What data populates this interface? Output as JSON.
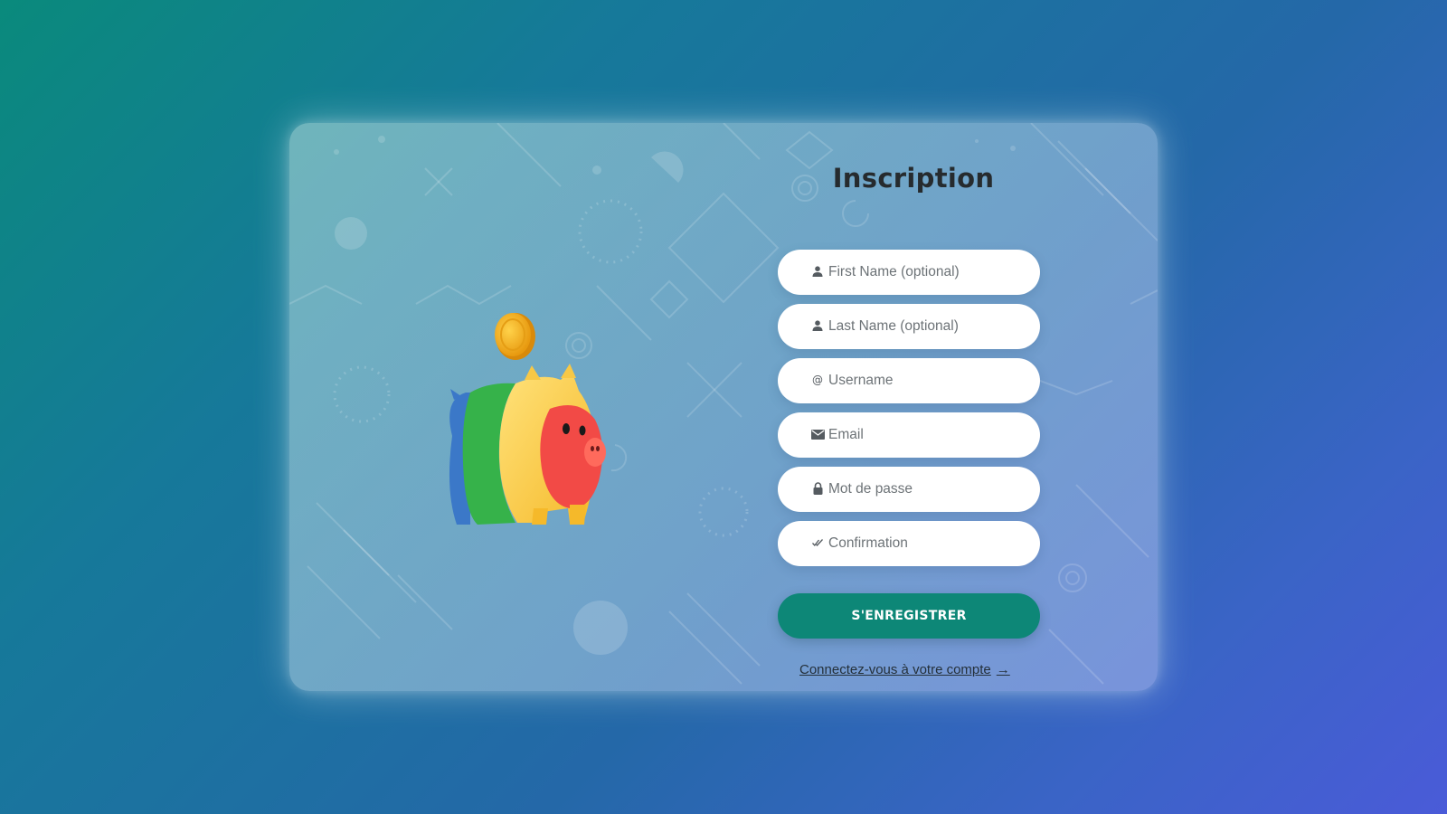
{
  "signup": {
    "title": "Inscription",
    "fields": [
      {
        "icon": "person-icon",
        "placeholder": "First Name (optional)",
        "value": ""
      },
      {
        "icon": "person-icon",
        "placeholder": "Last Name (optional)",
        "value": ""
      },
      {
        "icon": "at-icon",
        "placeholder": "Username",
        "value": ""
      },
      {
        "icon": "envelope-icon",
        "placeholder": "Email",
        "value": ""
      },
      {
        "icon": "lock-icon",
        "placeholder": "Mot de passe",
        "value": ""
      },
      {
        "icon": "double-check-icon",
        "placeholder": "Confirmation",
        "value": ""
      }
    ],
    "register_label": "S'ENREGISTRER",
    "login_link_label": "Connectez-vous à votre compte",
    "login_arrow_icon": "arrow-right-icon"
  },
  "illustration": {
    "name": "piggy-bank-icon",
    "coin": "coin-icon"
  },
  "colors": {
    "button": "#0d8777",
    "title": "#262b2e",
    "background_start": "#0a8a7c",
    "background_end": "#4a5bd8"
  }
}
